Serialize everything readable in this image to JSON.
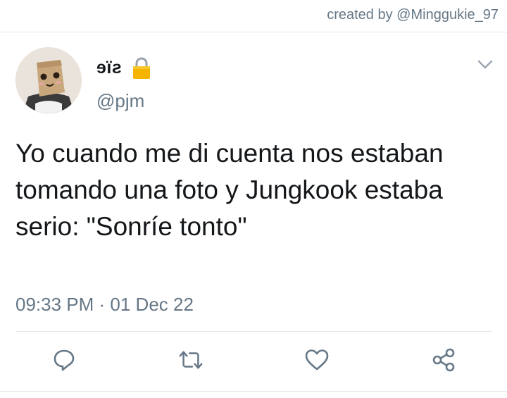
{
  "header": {
    "credit": "created by @Minggukie_97"
  },
  "tweet": {
    "display_name": "ɘïƨ",
    "handle": "@pjm",
    "text": "Yo cuando me di cuenta nos estaban tomando una foto y Jungkook estaba serio: \"Sonríe tonto\"",
    "timestamp": "09:33 PM · 01 Dec 22",
    "protected": true
  },
  "icons": {
    "avatar": "avatar-photo",
    "lock": "lock-icon",
    "menu": "chevron-down-icon",
    "actions": [
      "reply-icon",
      "retweet-icon",
      "like-icon",
      "share-icon"
    ]
  },
  "colors": {
    "text": "#14171a",
    "secondary": "#657786",
    "divider": "#e1e8ed",
    "lock": "#f4b400"
  }
}
